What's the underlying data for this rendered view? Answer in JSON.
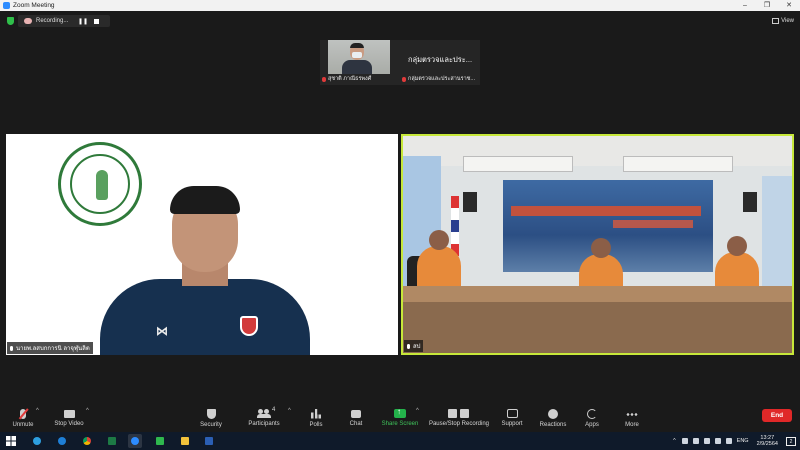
{
  "window": {
    "title": "Zoom Meeting",
    "controls": [
      "–",
      "❐",
      "✕"
    ]
  },
  "recording": {
    "label": "Recording..."
  },
  "view_button": {
    "label": "View"
  },
  "thumbnails": [
    {
      "name": "สุชาติ ภาณีธรพงศ์"
    },
    {
      "title": "กลุ่มตรวจและประ...",
      "name": "กลุ่มตรวจและประสานราช..."
    }
  ],
  "main_tiles": {
    "left_name": "นายพ.ลสบกการนิ ลาจุฬุนลิต",
    "right_name": "สป"
  },
  "toolbar": {
    "unmute": "Unmute",
    "stop_video": "Stop Video",
    "security": "Security",
    "participants": "Participants",
    "participants_count": "4",
    "polls": "Polls",
    "chat": "Chat",
    "share_screen": "Share Screen",
    "pause_stop_recording": "Pause/Stop Recording",
    "support": "Support",
    "reactions": "Reactions",
    "apps": "Apps",
    "more": "More",
    "end": "End"
  },
  "taskbar": {
    "language": "ENG",
    "time": "13:27",
    "date": "2/9/2564",
    "notifications": "2"
  },
  "colors": {
    "active_speaker_border": "#c7e83a",
    "share_green": "#24b24b",
    "end_red": "#e02828",
    "muted_red": "#e03a3a"
  }
}
